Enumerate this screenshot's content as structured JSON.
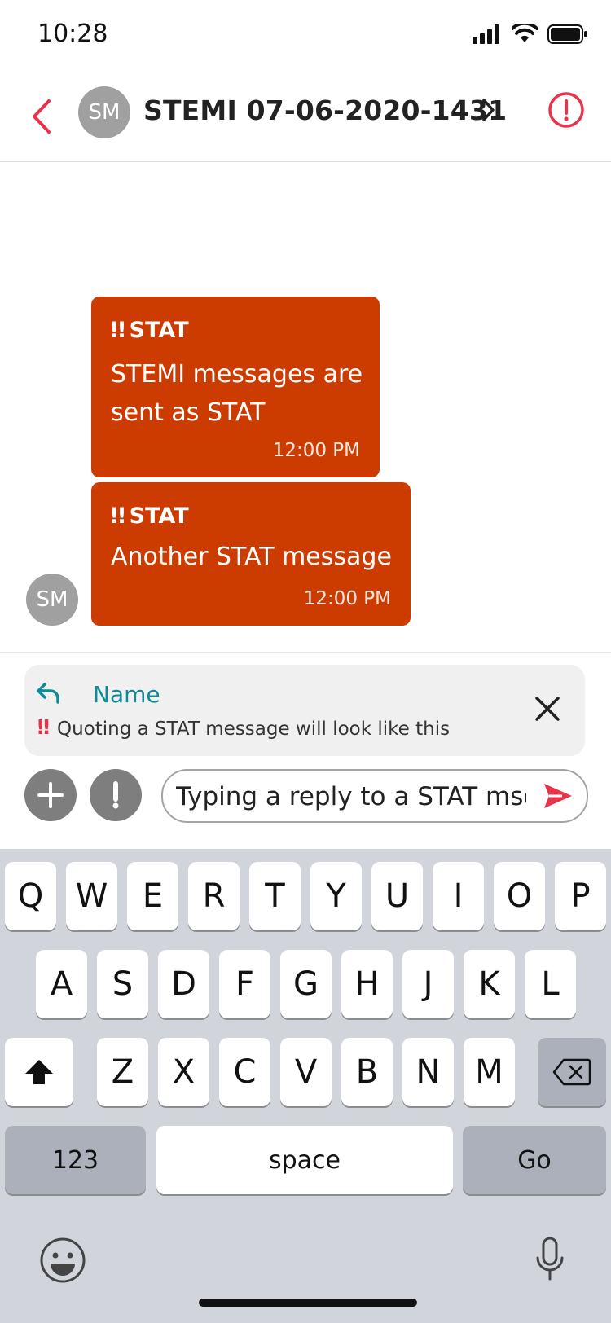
{
  "status_bar": {
    "time": "10:28"
  },
  "header": {
    "avatar_initials": "SM",
    "title": "STEMI 07-06-2020-1431"
  },
  "messages": [
    {
      "priority": "STAT",
      "text": "STEMI messages are sent as STAT",
      "time": "12:00 PM"
    },
    {
      "priority": "STAT",
      "text": "Another STAT message",
      "time": "12:00 PM"
    }
  ],
  "sender_avatar": "SM",
  "quote": {
    "name": "Name",
    "text": "Quoting a STAT message will look like this"
  },
  "compose": {
    "value": "Typing a reply to a STAT msg"
  },
  "keyboard": {
    "row1": [
      "Q",
      "W",
      "E",
      "R",
      "T",
      "Y",
      "U",
      "I",
      "O",
      "P"
    ],
    "row2": [
      "A",
      "S",
      "D",
      "F",
      "G",
      "H",
      "J",
      "K",
      "L"
    ],
    "row3": [
      "Z",
      "X",
      "C",
      "V",
      "B",
      "N",
      "M"
    ],
    "numbers_label": "123",
    "space_label": "space",
    "go_label": "Go"
  },
  "colors": {
    "accent": "#e8344a",
    "stat_bubble": "#cc3c00",
    "link": "#0f8a96"
  },
  "icons": [
    "back-chevron-icon",
    "chevron-right-icon",
    "alert-circle-icon",
    "reply-icon",
    "close-icon",
    "plus-icon",
    "exclamation-icon",
    "send-icon",
    "shift-icon",
    "backspace-icon",
    "emoji-icon",
    "microphone-icon"
  ]
}
